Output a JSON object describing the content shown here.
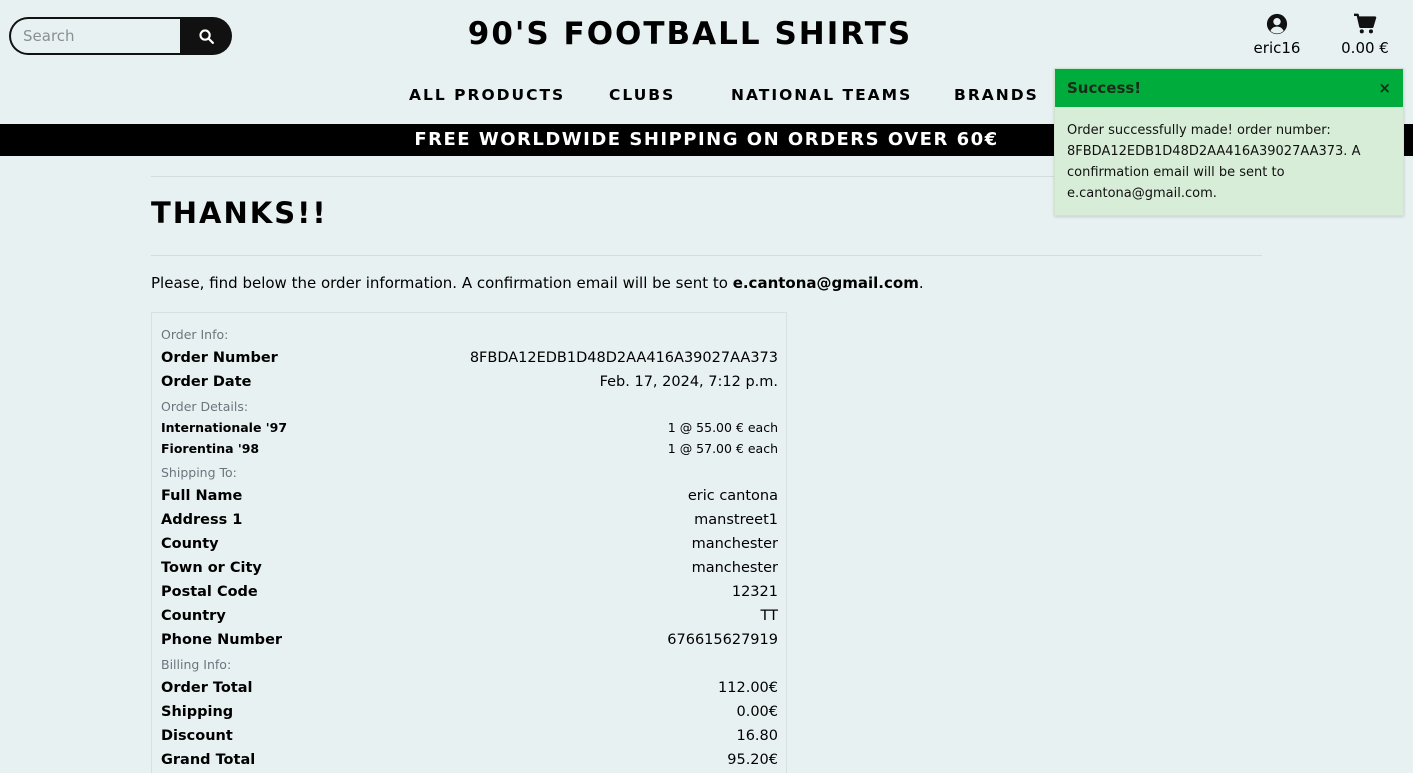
{
  "header": {
    "search_placeholder": "Search",
    "site_title": "90'S FOOTBALL SHIRTS",
    "account_label": "eric16",
    "cart_total": "0.00 €"
  },
  "nav": {
    "items": [
      "ALL PRODUCTS",
      "CLUBS",
      "NATIONAL TEAMS",
      "BRANDS"
    ]
  },
  "banner": "FREE WORLDWIDE SHIPPING ON ORDERS OVER 60€",
  "page": {
    "heading": "THANKS!!",
    "intro_text": "Please, find below the order information. A confirmation email will be sent to ",
    "intro_email": "e.cantona@gmail.com",
    "intro_end": "."
  },
  "order": {
    "info_label": "Order Info:",
    "order_number_key": "Order Number",
    "order_number": "8FBDA12EDB1D48D2AA416A39027AA373",
    "order_date_key": "Order Date",
    "order_date": "Feb. 17, 2024, 7:12 p.m.",
    "details_label": "Order Details:",
    "items": [
      {
        "name": "Internationale '97",
        "qty_price": "1 @ 55.00 € each"
      },
      {
        "name": "Fiorentina '98",
        "qty_price": "1 @ 57.00 € each"
      }
    ],
    "shipping_label": "Shipping To:",
    "shipping": [
      {
        "key": "Full Name",
        "value": "eric cantona"
      },
      {
        "key": "Address 1",
        "value": "manstreet1"
      },
      {
        "key": "County",
        "value": "manchester"
      },
      {
        "key": "Town or City",
        "value": "manchester"
      },
      {
        "key": "Postal Code",
        "value": "12321"
      },
      {
        "key": "Country",
        "value": "TT"
      },
      {
        "key": "Phone Number",
        "value": "676615627919"
      }
    ],
    "billing_label": "Billing Info:",
    "billing": [
      {
        "key": "Order Total",
        "value": "112.00€"
      },
      {
        "key": "Shipping",
        "value": "0.00€"
      },
      {
        "key": "Discount",
        "value": "16.80"
      },
      {
        "key": "Grand Total",
        "value": "95.20€"
      }
    ]
  },
  "toast": {
    "title": "Success!",
    "close": "×",
    "message": "Order successfully made! order number: 8FBDA12EDB1D48D2AA416A39027AA373. A confirmation email will be sent to e.cantona@gmail.com."
  },
  "colors": {
    "background": "#e8f1f2",
    "toast_header": "#00ad3c",
    "toast_body": "#d8edd8",
    "banner": "#000000"
  }
}
